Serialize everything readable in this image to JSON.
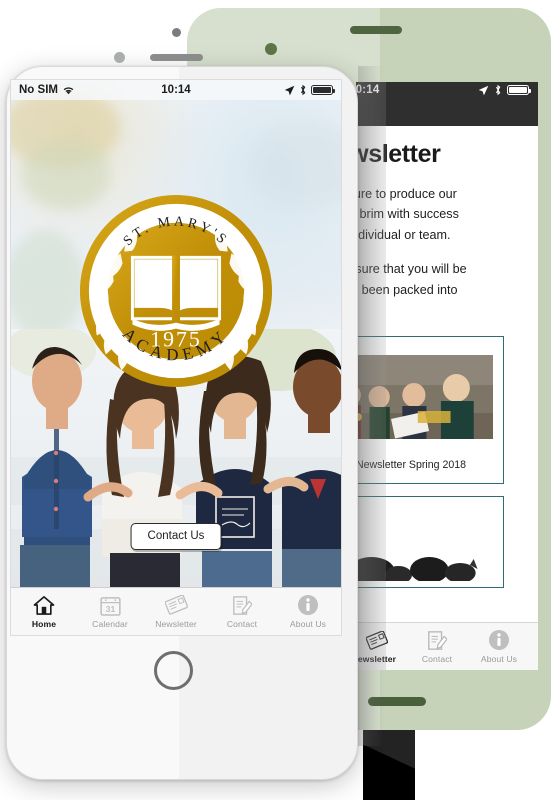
{
  "back_phone": {
    "bezel_color": "#c6d3b9",
    "status_bar": {
      "time": "10:14",
      "location_icon": "location-arrow",
      "bluetooth_icon": "bluetooth",
      "battery_icon": "battery-full"
    },
    "page_title": "Newsletter",
    "paragraphs": [
      "s pleasure to produce our\nd to the brim with success\n; be it individual or team.",
      "we are sure that you will be\nuch has been packed into\ne term!"
    ],
    "cards": [
      {
        "caption": "Newsletter Spring 2018",
        "photo": "schoolgirls-group-photo"
      },
      {
        "caption": "",
        "photo": "trees-landscape-bw-photo"
      }
    ],
    "tabs": [
      {
        "label": "ewsletter",
        "icon": "newsletter-icon",
        "active": true
      },
      {
        "label": "Contact",
        "icon": "contact-icon",
        "active": false
      },
      {
        "label": "About Us",
        "icon": "about-icon",
        "active": false
      }
    ]
  },
  "front_phone": {
    "bezel_color": "#f2f2f2",
    "status_bar": {
      "carrier": "No SIM",
      "wifi_icon": "wifi",
      "time": "10:14",
      "location_icon": "location-arrow",
      "bluetooth_icon": "bluetooth",
      "battery_icon": "battery-full"
    },
    "logo": {
      "top_text": "ST. MARY'S",
      "bottom_text": "ACADEMY",
      "year": "1975",
      "emblem": "open-book",
      "gold": "#c8920f",
      "gold_light": "#d9a821"
    },
    "hero": {
      "image": "four-smiling-students"
    },
    "contact_button": {
      "label": "Contact Us"
    },
    "tabs": [
      {
        "label": "Home",
        "icon": "home-icon",
        "active": true
      },
      {
        "label": "Calendar",
        "icon": "calendar-icon",
        "day": "31",
        "active": false
      },
      {
        "label": "Newsletter",
        "icon": "newsletter-icon",
        "active": false
      },
      {
        "label": "Contact",
        "icon": "contact-icon",
        "active": false
      },
      {
        "label": "About Us",
        "icon": "about-icon",
        "active": false
      }
    ],
    "home_button": "home-button"
  }
}
